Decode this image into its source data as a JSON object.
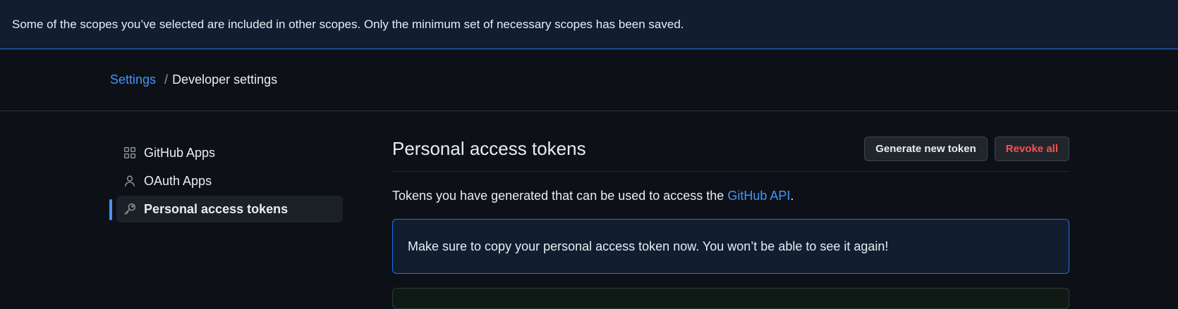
{
  "flash": {
    "message": "Some of the scopes you’ve selected are included in other scopes. Only the minimum set of necessary scopes has been saved."
  },
  "breadcrumb": {
    "settings_label": "Settings",
    "separator": "/",
    "current_label": "Developer settings"
  },
  "sidebar": {
    "items": [
      {
        "label": "GitHub Apps",
        "icon": "apps-icon",
        "active": false
      },
      {
        "label": "OAuth Apps",
        "icon": "person-icon",
        "active": false
      },
      {
        "label": "Personal access tokens",
        "icon": "key-icon",
        "active": true
      }
    ]
  },
  "main": {
    "title": "Personal access tokens",
    "generate_button": "Generate new token",
    "revoke_button": "Revoke all",
    "description_prefix": "Tokens you have generated that can be used to access the ",
    "description_link": "GitHub API",
    "description_suffix": ".",
    "notice": "Make sure to copy your personal access token now. You won’t be able to see it again!"
  },
  "colors": {
    "background": "#0d1117",
    "accent": "#4493f8",
    "danger": "#f85149",
    "notice_border": "#1f6feb"
  }
}
